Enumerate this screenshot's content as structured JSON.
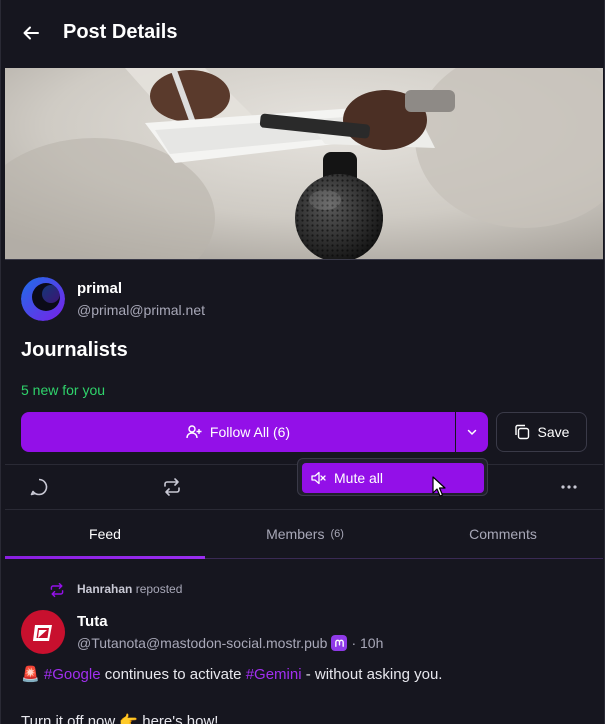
{
  "header": {
    "title": "Post Details",
    "back_icon": "arrow-left-icon"
  },
  "list": {
    "author_name": "primal",
    "author_handle": "@primal@primal.net",
    "title": "Journalists",
    "new_count": "5 new for you"
  },
  "actions": {
    "follow_all_label": "Follow All (6)",
    "save_label": "Save"
  },
  "dropdown": {
    "mute_all_label": "Mute all"
  },
  "tabs": [
    {
      "label": "Feed",
      "count": ""
    },
    {
      "label": "Members",
      "count": "(6)"
    },
    {
      "label": "Comments",
      "count": ""
    }
  ],
  "post": {
    "reposter": "Hanrahan",
    "reposted_label": "reposted",
    "author": "Tuta",
    "handle": "@Tutanota@mastodon-social.mostr.pub",
    "time": "· 10h",
    "text_prefix": "🚨",
    "tag1": "#Google",
    "text_mid": "continues to activate",
    "tag2": "#Gemini",
    "text_end": "- without asking you.",
    "text_line2": "Turn it off now 👉 here's how!"
  },
  "colors": {
    "accent": "#9310e8",
    "background": "#16161f",
    "new_count": "#2fd36b",
    "hashtag": "#a12ff0"
  }
}
